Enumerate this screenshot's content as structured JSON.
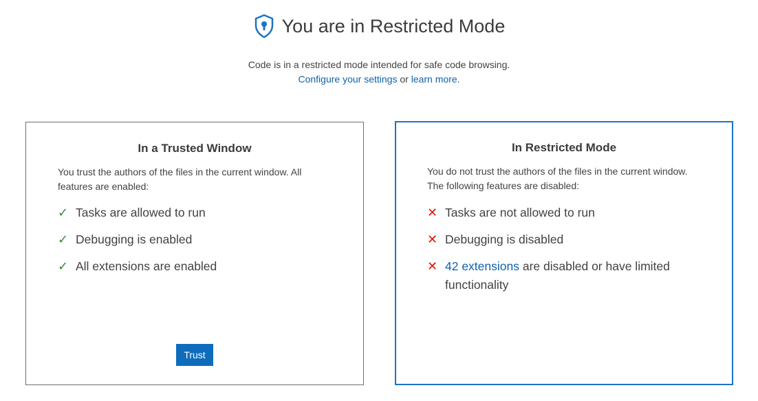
{
  "header": {
    "title": "You are in Restricted Mode",
    "subtitle": "Code is in a restricted mode intended for safe code browsing.",
    "configure_link": "Configure your settings",
    "or_text": " or ",
    "learn_link": "learn more",
    "period": "."
  },
  "trusted": {
    "title": "In a Trusted Window",
    "description": "You trust the authors of the files in the current window. All features are enabled:",
    "features": [
      "Tasks are allowed to run",
      "Debugging is enabled",
      "All extensions are enabled"
    ],
    "button_label": "Trust"
  },
  "restricted": {
    "title": "In Restricted Mode",
    "description": "You do not trust the authors of the files in the current window. The following features are disabled:",
    "features": [
      "Tasks are not allowed to run",
      "Debugging is disabled"
    ],
    "extensions_link": "42 extensions",
    "extensions_rest": " are disabled or have limited",
    "extensions_rest2": "functionality"
  },
  "colors": {
    "accent": "#0f6cbd",
    "check": "#388a34",
    "cross": "#e51400",
    "link": "#0f62ae"
  },
  "icons": {
    "header": "shield-lock-icon",
    "enabled": "check-icon",
    "disabled": "close-icon"
  }
}
